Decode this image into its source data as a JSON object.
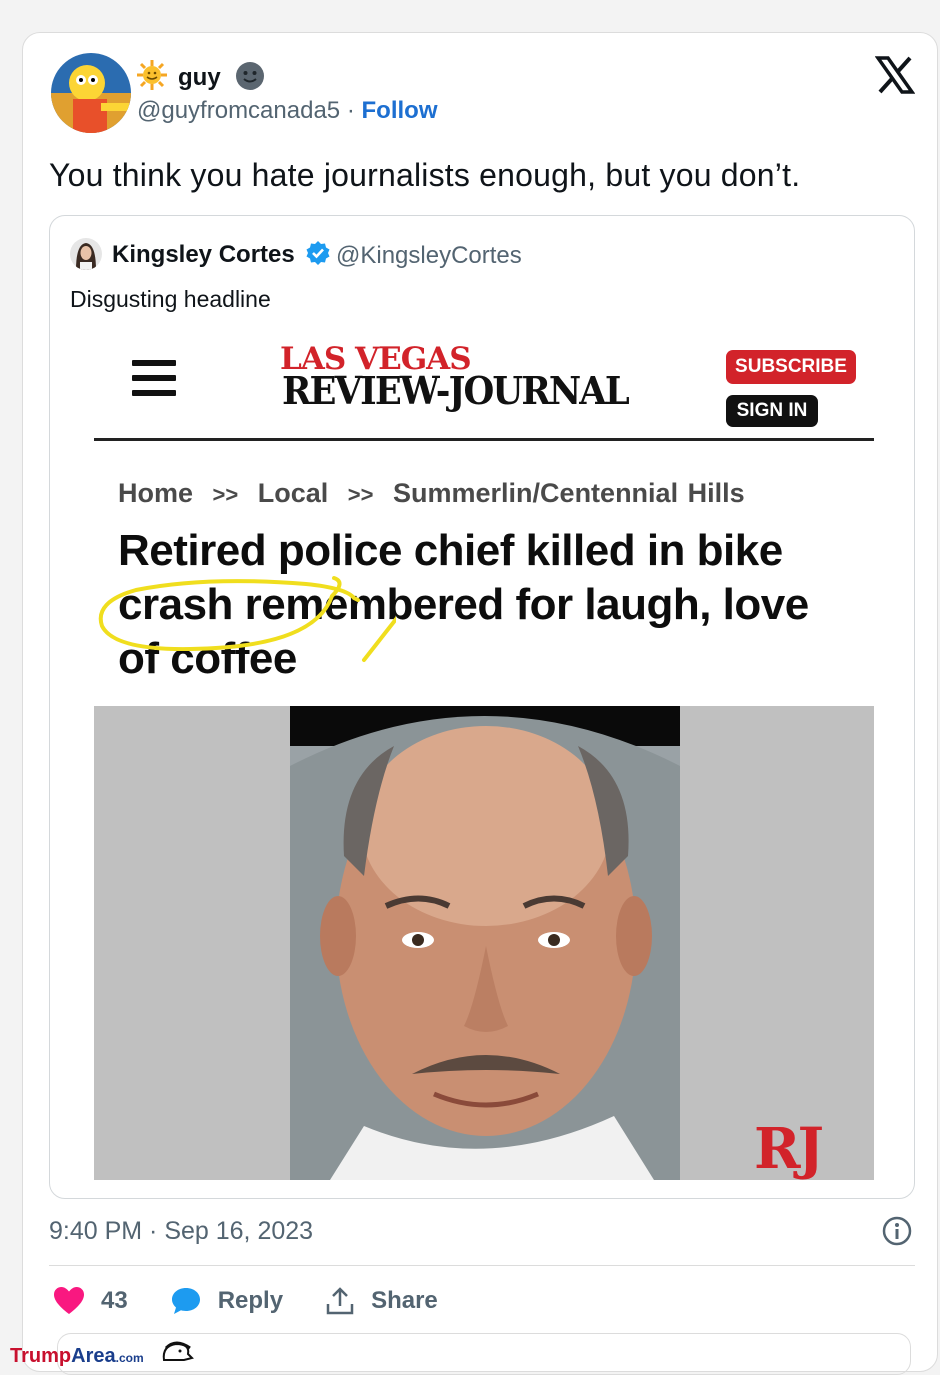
{
  "tweet": {
    "display_name": "guy",
    "handle": "@guyfromcanada5",
    "separator": "·",
    "follow_label": "Follow",
    "text": "You think you hate journalists enough, but you don’t.",
    "timestamp": "9:40 PM · Sep 16, 2023",
    "likes": "43",
    "reply_label": "Reply",
    "share_label": "Share"
  },
  "quote": {
    "display_name": "Kingsley Cortes",
    "handle": "@KingsleyCortes",
    "text": "Disgusting headline"
  },
  "article": {
    "logo_top": "LAS VEGAS",
    "logo_bottom": "REVIEW-JOURNAL",
    "subscribe_label": "SUBSCRIBE",
    "signin_label": "SIGN IN",
    "breadcrumb": [
      "Home",
      "Local",
      "Summerlin/Centennial Hills"
    ],
    "breadcrumb_sep": ">>",
    "headline": "Retired police chief killed in bike crash remembered for laugh, love of coffee",
    "photo_mark": "RJ"
  },
  "watermark": {
    "part1": "Trump",
    "part2": "Area",
    "part3": ".com"
  },
  "colors": {
    "brand_red": "#d2232a",
    "follow_blue": "#1d6fd1",
    "like_pink": "#f91880",
    "verified_blue": "#1d9bf0",
    "highlight_yellow": "#f0de1e"
  }
}
